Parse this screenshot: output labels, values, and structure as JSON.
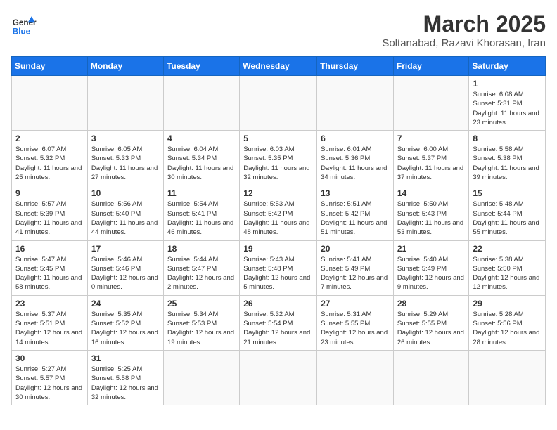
{
  "header": {
    "logo_general": "General",
    "logo_blue": "Blue",
    "month_title": "March 2025",
    "subtitle": "Soltanabad, Razavi Khorasan, Iran"
  },
  "weekdays": [
    "Sunday",
    "Monday",
    "Tuesday",
    "Wednesday",
    "Thursday",
    "Friday",
    "Saturday"
  ],
  "weeks": [
    [
      null,
      null,
      null,
      null,
      null,
      null,
      {
        "day": 1,
        "sunrise": "6:08 AM",
        "sunset": "5:31 PM",
        "daylight": "11 hours and 23 minutes."
      }
    ],
    [
      {
        "day": 2,
        "sunrise": "6:07 AM",
        "sunset": "5:32 PM",
        "daylight": "11 hours and 25 minutes."
      },
      {
        "day": 3,
        "sunrise": "6:05 AM",
        "sunset": "5:33 PM",
        "daylight": "11 hours and 27 minutes."
      },
      {
        "day": 4,
        "sunrise": "6:04 AM",
        "sunset": "5:34 PM",
        "daylight": "11 hours and 30 minutes."
      },
      {
        "day": 5,
        "sunrise": "6:03 AM",
        "sunset": "5:35 PM",
        "daylight": "11 hours and 32 minutes."
      },
      {
        "day": 6,
        "sunrise": "6:01 AM",
        "sunset": "5:36 PM",
        "daylight": "11 hours and 34 minutes."
      },
      {
        "day": 7,
        "sunrise": "6:00 AM",
        "sunset": "5:37 PM",
        "daylight": "11 hours and 37 minutes."
      },
      {
        "day": 8,
        "sunrise": "5:58 AM",
        "sunset": "5:38 PM",
        "daylight": "11 hours and 39 minutes."
      }
    ],
    [
      {
        "day": 9,
        "sunrise": "5:57 AM",
        "sunset": "5:39 PM",
        "daylight": "11 hours and 41 minutes."
      },
      {
        "day": 10,
        "sunrise": "5:56 AM",
        "sunset": "5:40 PM",
        "daylight": "11 hours and 44 minutes."
      },
      {
        "day": 11,
        "sunrise": "5:54 AM",
        "sunset": "5:41 PM",
        "daylight": "11 hours and 46 minutes."
      },
      {
        "day": 12,
        "sunrise": "5:53 AM",
        "sunset": "5:42 PM",
        "daylight": "11 hours and 48 minutes."
      },
      {
        "day": 13,
        "sunrise": "5:51 AM",
        "sunset": "5:42 PM",
        "daylight": "11 hours and 51 minutes."
      },
      {
        "day": 14,
        "sunrise": "5:50 AM",
        "sunset": "5:43 PM",
        "daylight": "11 hours and 53 minutes."
      },
      {
        "day": 15,
        "sunrise": "5:48 AM",
        "sunset": "5:44 PM",
        "daylight": "11 hours and 55 minutes."
      }
    ],
    [
      {
        "day": 16,
        "sunrise": "5:47 AM",
        "sunset": "5:45 PM",
        "daylight": "11 hours and 58 minutes."
      },
      {
        "day": 17,
        "sunrise": "5:46 AM",
        "sunset": "5:46 PM",
        "daylight": "12 hours and 0 minutes."
      },
      {
        "day": 18,
        "sunrise": "5:44 AM",
        "sunset": "5:47 PM",
        "daylight": "12 hours and 2 minutes."
      },
      {
        "day": 19,
        "sunrise": "5:43 AM",
        "sunset": "5:48 PM",
        "daylight": "12 hours and 5 minutes."
      },
      {
        "day": 20,
        "sunrise": "5:41 AM",
        "sunset": "5:49 PM",
        "daylight": "12 hours and 7 minutes."
      },
      {
        "day": 21,
        "sunrise": "5:40 AM",
        "sunset": "5:49 PM",
        "daylight": "12 hours and 9 minutes."
      },
      {
        "day": 22,
        "sunrise": "5:38 AM",
        "sunset": "5:50 PM",
        "daylight": "12 hours and 12 minutes."
      }
    ],
    [
      {
        "day": 23,
        "sunrise": "5:37 AM",
        "sunset": "5:51 PM",
        "daylight": "12 hours and 14 minutes."
      },
      {
        "day": 24,
        "sunrise": "5:35 AM",
        "sunset": "5:52 PM",
        "daylight": "12 hours and 16 minutes."
      },
      {
        "day": 25,
        "sunrise": "5:34 AM",
        "sunset": "5:53 PM",
        "daylight": "12 hours and 19 minutes."
      },
      {
        "day": 26,
        "sunrise": "5:32 AM",
        "sunset": "5:54 PM",
        "daylight": "12 hours and 21 minutes."
      },
      {
        "day": 27,
        "sunrise": "5:31 AM",
        "sunset": "5:55 PM",
        "daylight": "12 hours and 23 minutes."
      },
      {
        "day": 28,
        "sunrise": "5:29 AM",
        "sunset": "5:55 PM",
        "daylight": "12 hours and 26 minutes."
      },
      {
        "day": 29,
        "sunrise": "5:28 AM",
        "sunset": "5:56 PM",
        "daylight": "12 hours and 28 minutes."
      }
    ],
    [
      {
        "day": 30,
        "sunrise": "5:27 AM",
        "sunset": "5:57 PM",
        "daylight": "12 hours and 30 minutes."
      },
      {
        "day": 31,
        "sunrise": "5:25 AM",
        "sunset": "5:58 PM",
        "daylight": "12 hours and 32 minutes."
      },
      null,
      null,
      null,
      null,
      null
    ]
  ]
}
